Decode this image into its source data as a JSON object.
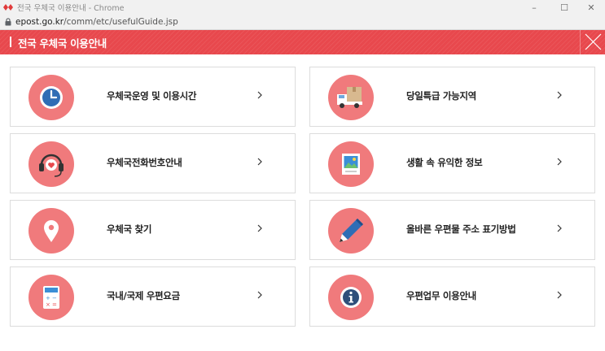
{
  "browser": {
    "window_title": "전국 우체국 이용안내 - Chrome",
    "url_host": "epost.go.kr",
    "url_path": "/comm/etc/usefulGuide.jsp",
    "window_controls": [
      "–",
      "☐",
      "✕"
    ]
  },
  "header": {
    "title": "전국 우체국 이용안내",
    "background_color": "#e8484d"
  },
  "colors": {
    "icon_circle": "#f07a7c",
    "accent": "#e8484d"
  },
  "items": [
    {
      "label": "우체국운영 및 이용시간",
      "icon": "clock-icon"
    },
    {
      "label": "당일특급 가능지역",
      "icon": "delivery-truck-icon"
    },
    {
      "label": "우체국전화번호안내",
      "icon": "headset-icon"
    },
    {
      "label": "생활 속 유익한 정보",
      "icon": "picture-frame-icon"
    },
    {
      "label": "우체국 찾기",
      "icon": "map-pin-icon"
    },
    {
      "label": "올바른 우편물 주소 표기방법",
      "icon": "pencil-icon"
    },
    {
      "label": "국내/국제 우편요금",
      "icon": "calculator-icon"
    },
    {
      "label": "우편업무 이용안내",
      "icon": "info-icon"
    }
  ],
  "chevron": "chevron-right-icon"
}
